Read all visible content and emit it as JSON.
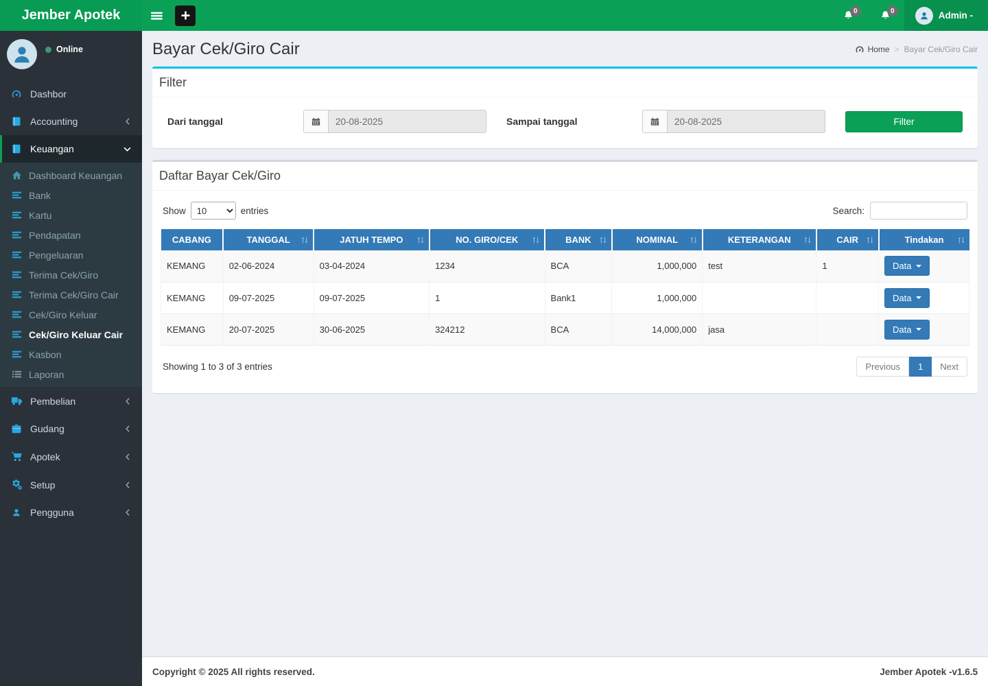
{
  "colors": {
    "navbar_green": "#0aa157",
    "brand_green": "#079b53",
    "user_section_green": "#08904e",
    "sidebar_bg": "#2a3139",
    "submenu_bg": "#2c3b41",
    "active_item_bg": "#1e282c",
    "table_header_blue": "#337ab7",
    "info_box_border": "#00c0ef",
    "default_box_border": "#d2d6de",
    "content_bg": "#ecf0f5",
    "icon_blue": "#28a7e0"
  },
  "navbar": {
    "brand": "Jember Apotek",
    "plus_label": "+",
    "bell1_count": "0",
    "bell2_count": "0",
    "user_label": "Admin -"
  },
  "sidebar": {
    "status": "Online",
    "items": [
      {
        "label": "Dashbor",
        "icon": "tachometer-icon"
      },
      {
        "label": "Accounting",
        "icon": "book-icon",
        "chevron": "left"
      },
      {
        "label": "Keuangan",
        "icon": "book-icon",
        "chevron": "down",
        "active": true
      },
      {
        "label": "Pembelian",
        "icon": "truck-icon",
        "chevron": "left"
      },
      {
        "label": "Gudang",
        "icon": "briefcase-icon",
        "chevron": "left"
      },
      {
        "label": "Apotek",
        "icon": "cart-icon",
        "chevron": "left"
      },
      {
        "label": "Setup",
        "icon": "gears-icon",
        "chevron": "left"
      },
      {
        "label": "Pengguna",
        "icon": "user-icon",
        "chevron": "left"
      }
    ],
    "keuangan_submenu": [
      {
        "label": "Dashboard Keuangan",
        "icon": "home-icon"
      },
      {
        "label": "Bank",
        "icon": "bars-icon"
      },
      {
        "label": "Kartu",
        "icon": "bars-icon"
      },
      {
        "label": "Pendapatan",
        "icon": "bars-icon"
      },
      {
        "label": "Pengeluaran",
        "icon": "bars-icon"
      },
      {
        "label": "Terima Cek/Giro",
        "icon": "bars-icon"
      },
      {
        "label": "Terima Cek/Giro Cair",
        "icon": "bars-icon"
      },
      {
        "label": "Cek/Giro Keluar",
        "icon": "bars-icon"
      },
      {
        "label": "Cek/Giro Keluar Cair",
        "icon": "bars-icon",
        "active": true
      },
      {
        "label": "Kasbon",
        "icon": "bars-icon"
      },
      {
        "label": "Laporan",
        "icon": "list-icon"
      }
    ]
  },
  "content": {
    "page_title": "Bayar Cek/Giro Cair",
    "breadcrumb": {
      "home": "Home",
      "current": "Bayar Cek/Giro Cair"
    },
    "filter": {
      "title": "Filter",
      "from_label": "Dari tanggal",
      "from_value": "20-08-2025",
      "to_label": "Sampai tanggal",
      "to_value": "20-08-2025",
      "button_label": "Filter"
    },
    "table_box": {
      "title": "Daftar Bayar Cek/Giro",
      "show_label": "Show",
      "page_length": "10",
      "entries_label": "entries",
      "search_label": "Search:",
      "search_value": "",
      "columns": [
        {
          "label": "CABANG",
          "sortable": false
        },
        {
          "label": "TANGGAL",
          "sortable": true
        },
        {
          "label": "JATUH TEMPO",
          "sortable": true
        },
        {
          "label": "NO. GIRO/CEK",
          "sortable": true
        },
        {
          "label": "BANK",
          "sortable": true
        },
        {
          "label": "NOMINAL",
          "sortable": true
        },
        {
          "label": "KETERANGAN",
          "sortable": true
        },
        {
          "label": "CAIR",
          "sortable": true
        },
        {
          "label": "Tindakan",
          "sortable": true
        }
      ],
      "rows": [
        {
          "cabang": "KEMANG",
          "tanggal": "02-06-2024",
          "jatuh_tempo": "03-04-2024",
          "no_giro": "1234",
          "bank": "BCA",
          "nominal": "1,000,000",
          "keterangan": "test",
          "cair": "1",
          "action": "Data"
        },
        {
          "cabang": "KEMANG",
          "tanggal": "09-07-2025",
          "jatuh_tempo": "09-07-2025",
          "no_giro": "1",
          "bank": "Bank1",
          "nominal": "1,000,000",
          "keterangan": "",
          "cair": "",
          "action": "Data"
        },
        {
          "cabang": "KEMANG",
          "tanggal": "20-07-2025",
          "jatuh_tempo": "30-06-2025",
          "no_giro": "324212",
          "bank": "BCA",
          "nominal": "14,000,000",
          "keterangan": "jasa",
          "cair": "",
          "action": "Data"
        }
      ],
      "info": "Showing 1 to 3 of 3 entries",
      "pagination": {
        "previous": "Previous",
        "page": "1",
        "next": "Next"
      }
    }
  },
  "footer": {
    "copyright": "Copyright © 2025 All rights reserved.",
    "version": "Jember Apotek -v1.6.5"
  }
}
